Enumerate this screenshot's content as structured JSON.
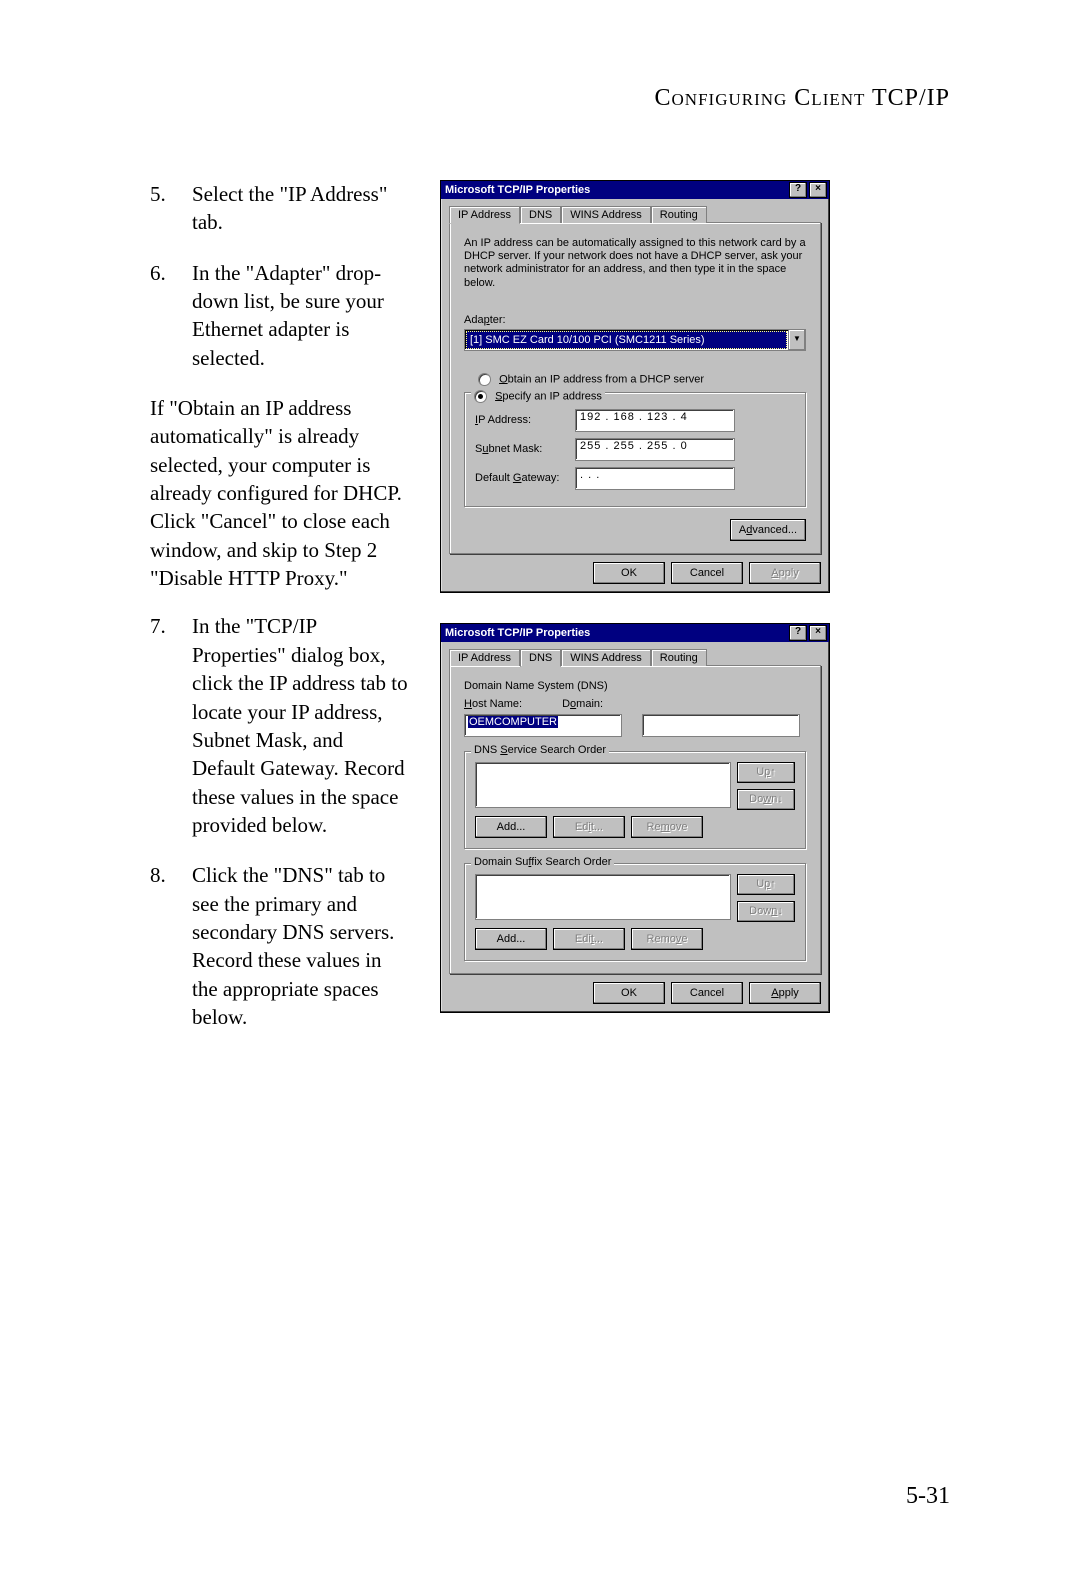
{
  "running_head": "Configuring Client TCP/IP",
  "page_number": "5-31",
  "steps": {
    "s5": {
      "num": "5.",
      "text": "Select the \"IP Address\" tab."
    },
    "s6": {
      "num": "6.",
      "text": "In the \"Adapter\" drop-down list, be sure your Ethernet adapter is selected."
    },
    "para1": "If \"Obtain an IP address automatically\" is already selected, your computer is already configured for DHCP. Click \"Cancel\" to close each window, and skip to Step 2 \"Disable HTTP Proxy.\"",
    "s7": {
      "num": "7.",
      "text": "In the \"TCP/IP Properties\" dialog box, click the IP address tab to locate your IP address, Subnet Mask, and Default Gateway. Record these values in the space provided below."
    },
    "s8": {
      "num": "8.",
      "text": "Click the \"DNS\" tab to see the primary and secondary DNS servers. Record these values in the appropriate spaces below."
    }
  },
  "dialog1": {
    "title": "Microsoft TCP/IP Properties",
    "tabs": {
      "ip": "IP Address",
      "dns": "DNS",
      "wins": "WINS Address",
      "routing": "Routing"
    },
    "desc": "An IP address can be automatically assigned to this network card by a DHCP server. If your network does not have a DHCP server, ask your network administrator for an address, and then type it in the space below.",
    "adapter_label": "Adapter:",
    "adapter_value": "[1] SMC EZ Card 10/100 PCI (SMC1211 Series)",
    "radio_obtain": "Obtain an IP address from a DHCP server",
    "radio_specify": "Specify an IP address",
    "fields": {
      "ip_label": "IP Address:",
      "ip_value": "192 . 168 . 123 .   4",
      "mask_label": "Subnet Mask:",
      "mask_value": "255 . 255 . 255 .   0",
      "gw_label": "Default Gateway:",
      "gw_value": " .       .       ."
    },
    "advanced": "Advanced...",
    "ok": "OK",
    "cancel": "Cancel",
    "apply": "Apply"
  },
  "dialog2": {
    "title": "Microsoft TCP/IP Properties",
    "tabs": {
      "ip": "IP Address",
      "dns": "DNS",
      "wins": "WINS Address",
      "routing": "Routing"
    },
    "dns_heading": "Domain Name System (DNS)",
    "host_label": "Host Name:",
    "host_value": "OEMCOMPUTER",
    "domain_label": "Domain:",
    "domain_value": "",
    "group1": "DNS Service Search Order",
    "group2": "Domain Suffix Search Order",
    "up": "Up↑",
    "down": "Down↓",
    "add": "Add...",
    "edit": "Edit...",
    "remove": "Remove",
    "ok": "OK",
    "cancel": "Cancel",
    "apply": "Apply"
  }
}
